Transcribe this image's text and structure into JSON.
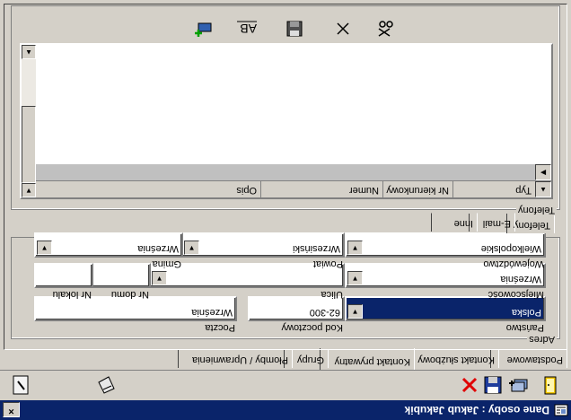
{
  "window": {
    "title": "Dane osoby : Jakub Jakubik",
    "close_label": "×"
  },
  "toolbar": {
    "icons": [
      "new-document-icon",
      "add-icon",
      "save-icon",
      "cancel-icon",
      "edit-icon",
      "help-icon"
    ]
  },
  "tabs": [
    {
      "label": "Podstawowe"
    },
    {
      "label": "Kontakt służbowy"
    },
    {
      "label": "Kontakt prywatny"
    },
    {
      "label": "Grupy"
    },
    {
      "label": "Płomby / Uprawnienia"
    }
  ],
  "active_tab": 2,
  "address": {
    "group_label": "Adres",
    "panstwo": {
      "label": "Państwo",
      "value": "Polska"
    },
    "kod": {
      "label": "Kod pocztowy",
      "value": "62-300"
    },
    "poczta": {
      "label": "Poczta",
      "value": "Września"
    },
    "miejscowosc": {
      "label": "Miejscowość",
      "value": "Września"
    },
    "ulica": {
      "label": "Ulica",
      "value": ""
    },
    "nr_domu": {
      "label": "Nr domu",
      "value": ""
    },
    "nr_lokalu": {
      "label": "Nr lokalu",
      "value": ""
    },
    "wojewodztwo": {
      "label": "Województwo",
      "value": "Wielkopolskie"
    },
    "powiat": {
      "label": "Powiat",
      "value": "Wrzesiński"
    },
    "gmina": {
      "label": "Gmina",
      "value": "Września"
    }
  },
  "contact_tabs": [
    {
      "label": "Telefony"
    },
    {
      "label": "E-mail"
    },
    {
      "label": "Inne"
    }
  ],
  "phones": {
    "group_label": "Telefony",
    "columns": [
      "Typ",
      "Nr kierunkowy",
      "Numer",
      "Opis"
    ],
    "actions": [
      "ok-icon",
      "ab-icon",
      "save-icon",
      "delete-icon",
      "cut-icon"
    ]
  }
}
